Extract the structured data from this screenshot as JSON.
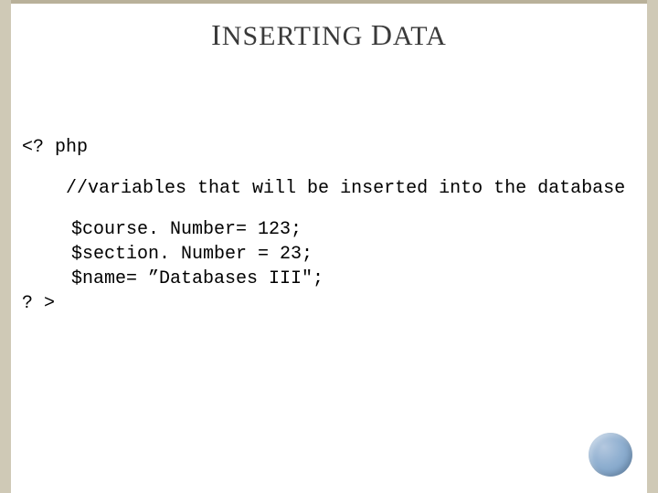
{
  "title": {
    "word1_cap": "I",
    "word1_rest": "NSERTING",
    "word2_cap": "D",
    "word2_rest": "ATA"
  },
  "code": {
    "open_tag": "<? php",
    "comment_line": "//variables that will be inserted into the database",
    "comment_lead": "    ",
    "var1": "$course. Number= 123;",
    "var2": "$section. Number = 23;",
    "var3": "$name= ”Databases III\";",
    "close_tag": "? >"
  }
}
